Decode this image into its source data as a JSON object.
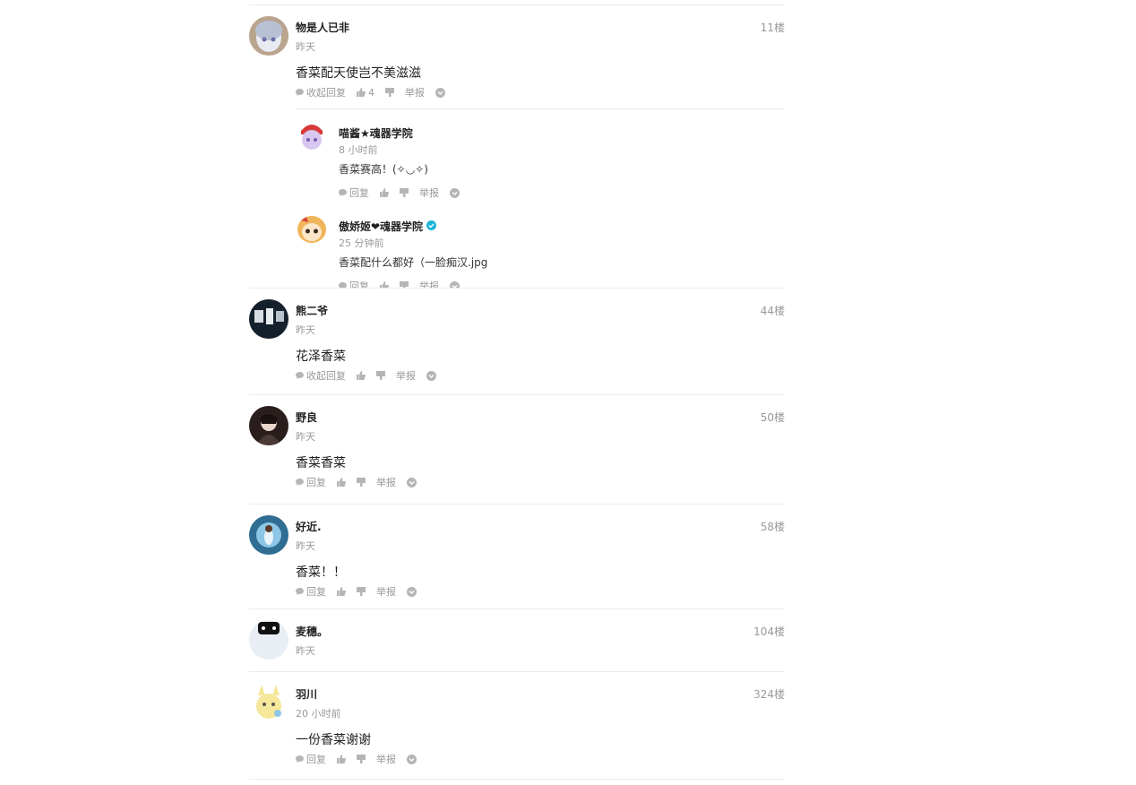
{
  "comments": [
    {
      "username": "物是人已非",
      "time": "昨天",
      "floor": "11楼",
      "text": "香菜配天使岂不美滋滋",
      "reply_label": "收起回复",
      "like_count": "4",
      "report_label": "举报",
      "avatar_color": "#9aa3b8"
    },
    {
      "username": "熊二爷",
      "time": "昨天",
      "floor": "44楼",
      "text": "花泽香菜",
      "reply_label": "收起回复",
      "like_count": "",
      "report_label": "举报",
      "avatar_color": "#1f2a36"
    },
    {
      "username": "野良",
      "time": "昨天",
      "floor": "50楼",
      "text": "香菜香菜",
      "reply_label": "回复",
      "like_count": "",
      "report_label": "举报",
      "avatar_color": "#3a2a26"
    },
    {
      "username": "好近.",
      "time": "昨天",
      "floor": "58楼",
      "text": "香菜！！",
      "reply_label": "回复",
      "like_count": "",
      "report_label": "举报",
      "avatar_color": "#3f7fa6"
    },
    {
      "username": "麦穗。",
      "time": "昨天",
      "floor": "104楼",
      "avatar_color": "#e8eef4"
    },
    {
      "username": "羽川",
      "time": "20 小时前",
      "floor": "324楼",
      "text": "一份香菜谢谢",
      "reply_label": "回复",
      "like_count": "",
      "report_label": "举报",
      "avatar_color": "#f3e7a6"
    }
  ],
  "replies": [
    {
      "username": "喵酱★魂器学院",
      "time": "8 小时前",
      "text": "香菜赛高！(✧◡✧)",
      "reply_label": "回复",
      "report_label": "举报",
      "avatar_color": "#c9b6e3"
    },
    {
      "username": "傲娇姬❤魂器学院",
      "time": "25 分钟前",
      "text": "香菜配什么都好（一脸痴汉.jpg",
      "reply_label": "回复",
      "report_label": "举报",
      "verified": true,
      "avatar_color": "#f3c98b"
    }
  ],
  "colors": {
    "verified_badge": "#1fb5d8",
    "muted_text": "#999999",
    "divider": "#ececec"
  },
  "icons": [
    "comment-icon",
    "thumbs-up-icon",
    "thumbs-down-icon",
    "more-circle-icon",
    "verified-badge-icon"
  ]
}
